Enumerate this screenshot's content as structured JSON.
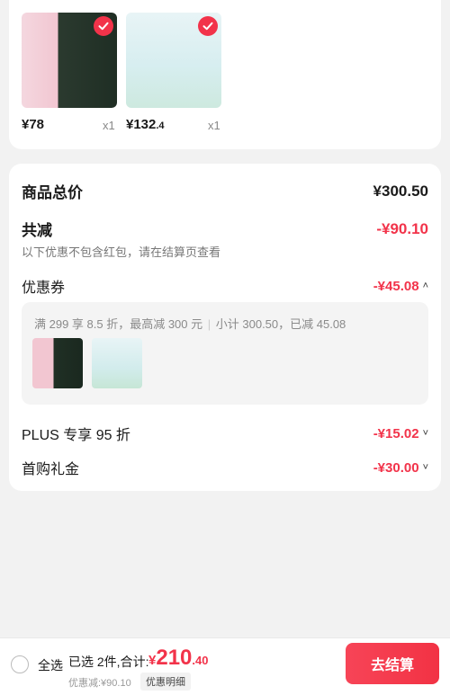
{
  "products": [
    {
      "price_currency": "¥",
      "price_int": "78",
      "price_dec": "",
      "qty": "x1",
      "image": "product-image-1"
    },
    {
      "price_currency": "¥",
      "price_int": "132",
      "price_dec": ".4",
      "qty": "x1",
      "image": "product-image-2"
    }
  ],
  "summary": {
    "goods_total_label": "商品总价",
    "goods_total_value": "¥300.50",
    "discount_label": "共减",
    "discount_value": "-¥90.10",
    "discount_hint": "以下优惠不包含红包，请在结算页查看",
    "coupon_label": "优惠券",
    "coupon_value": "-¥45.08",
    "coupon_rule": "满 299 享 8.5 折，最高减 300 元",
    "coupon_sep": "|",
    "coupon_subtotal": "小计 300.50，已减 45.08",
    "plus_label": "PLUS 专享 95 折",
    "plus_value": "-¥15.02",
    "firstbuy_label": "首购礼金",
    "firstbuy_value": "-¥30.00"
  },
  "bottom": {
    "select_all": "全选",
    "selected_info": "已选 2件,合计:",
    "total_currency": "¥",
    "total_int": "210",
    "total_dec": ".40",
    "discount_note": "优惠减:¥90.10",
    "detail_button": "优惠明细",
    "checkout_button": "去结算"
  },
  "colors": {
    "accent": "#f2334a"
  }
}
